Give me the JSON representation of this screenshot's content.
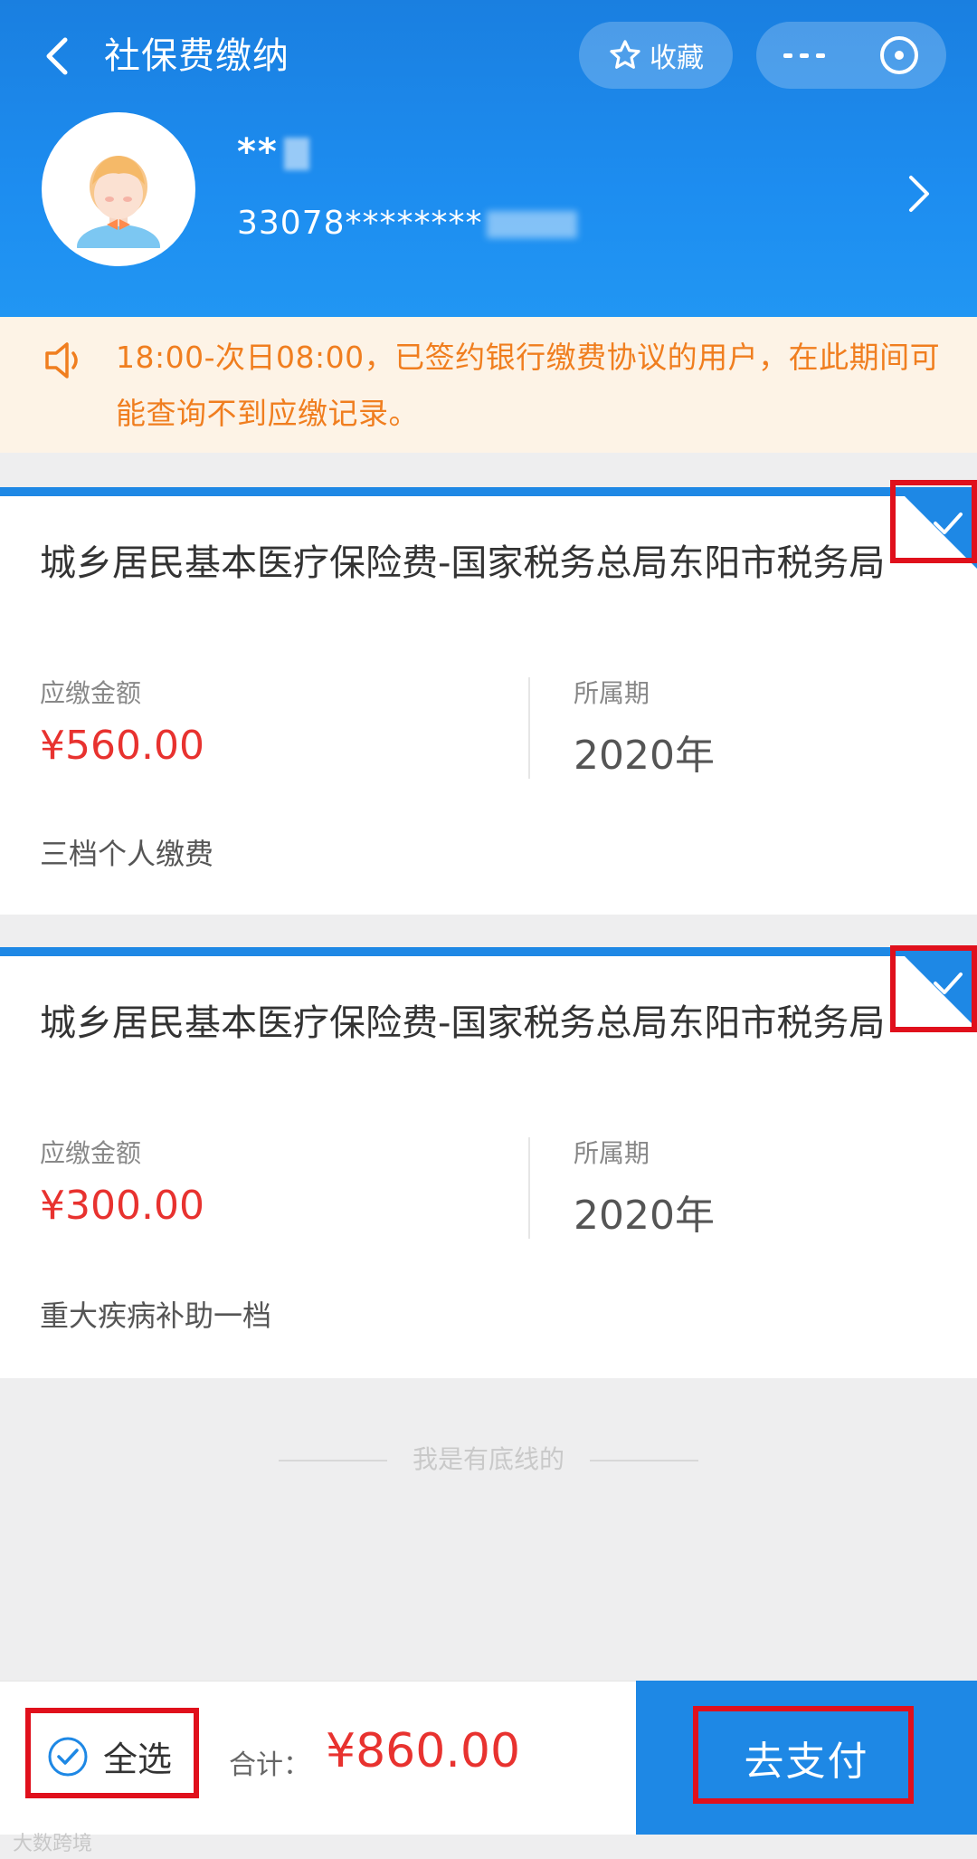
{
  "header": {
    "title": "社保费缴纳",
    "favorite_label": "收藏",
    "user_name": "**",
    "user_id": "33078********"
  },
  "notice": {
    "text": "18:00-次日08:00，已签约银行缴费协议的用户，在此期间可能查询不到应缴记录。"
  },
  "cards": [
    {
      "title": "城乡居民基本医疗保险费-国家税务总局东阳市税务局",
      "amount_label": "应缴金额",
      "amount": "¥560.00",
      "period_label": "所属期",
      "period": "2020年",
      "description": "三档个人缴费",
      "checked": true
    },
    {
      "title": "城乡居民基本医疗保险费-国家税务总局东阳市税务局",
      "amount_label": "应缴金额",
      "amount": "¥300.00",
      "period_label": "所属期",
      "period": "2020年",
      "description": "重大疾病补助一档",
      "checked": true
    }
  ],
  "end_text": "我是有底线的",
  "footer": {
    "select_all_label": "全选",
    "select_all_checked": true,
    "total_label": "合计：",
    "total_amount": "¥860.00",
    "pay_button": "去支付"
  },
  "watermark": "大数跨境",
  "colors": {
    "brand_blue": "#1e88e5",
    "amount_red": "#e8322f",
    "notice_orange": "#f07e1f",
    "notice_bg": "#fdf3e6",
    "highlight_red": "#e0101c"
  }
}
